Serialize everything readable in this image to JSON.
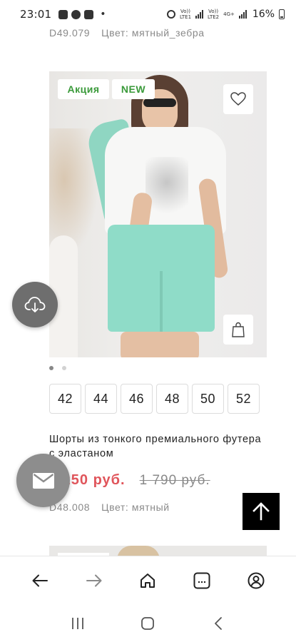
{
  "status_bar": {
    "time": "23:01",
    "notification_icons": [
      "image-icon",
      "whatsapp-icon",
      "youtube-icon"
    ],
    "dot": "•",
    "network_1_line1": "Vo))",
    "network_1_line2": "LTE1",
    "network_2_line1": "Vo))",
    "network_2_line2": "LTE2",
    "network_2_tag": "4G+",
    "battery": "16%"
  },
  "previous_product": {
    "sku": "D49.079",
    "color": "Цвет: мятный_зебра"
  },
  "product": {
    "badges": {
      "sale": "Акция",
      "new": "NEW"
    },
    "carousel": {
      "count": 2,
      "active": 0
    },
    "sizes": [
      "42",
      "44",
      "46",
      "48",
      "50",
      "52"
    ],
    "name": "Шорты из тонкого премиального футера с эластаном",
    "price_current": "1 250 руб.",
    "price_old": "1 790 руб.",
    "sku": "D48.008",
    "color": "Цвет: мятный"
  },
  "floating": {
    "cloud_icon": "cloud-download-icon",
    "mail_icon": "mail-icon",
    "scroll_icon": "arrow-up-icon"
  },
  "browser_bar": {
    "icons": [
      "back-arrow-icon",
      "forward-arrow-icon",
      "home-icon",
      "tabs-icon",
      "profile-icon"
    ],
    "tabs_label": "..."
  },
  "android_nav": {
    "icons": [
      "recent-apps-icon",
      "home-circle-icon",
      "back-chevron-icon"
    ]
  },
  "colors": {
    "accent_green": "#3a9a3a",
    "price_red": "#e0555b",
    "muted_gray": "#8a8a8a",
    "mint": "#8fdcc8"
  }
}
